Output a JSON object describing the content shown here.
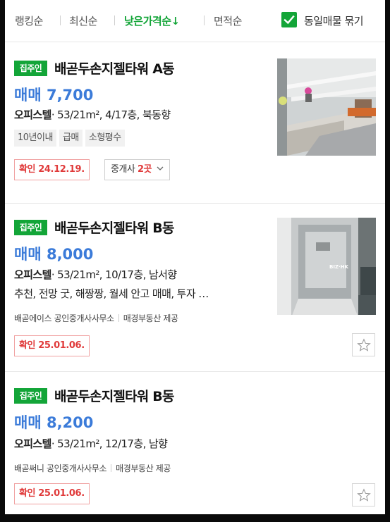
{
  "sort_bar": {
    "options": [
      {
        "label": "랭킹순"
      },
      {
        "label": "최신순"
      },
      {
        "label": "낮은가격순↓",
        "active": true
      },
      {
        "label": "면적순"
      }
    ],
    "same_listing_checkbox": {
      "label": "동일매물 묶기",
      "checked": true
    }
  },
  "listings": [
    {
      "badge": "집주인",
      "title": "배곧두손지젤타워 A동",
      "price": "매매 7,700",
      "type": "오피스텔",
      "spec": "· 53/21m², 4/17층, 북동향",
      "tags": [
        "10년이내",
        "급매",
        "소형평수"
      ],
      "confirm": "확인 24.12.19.",
      "agency_label": "중개사 ",
      "agency_count": "2곳",
      "thumbnail_icon": "room-interior-photo"
    },
    {
      "badge": "집주인",
      "title": "배곧두손지젤타워 B동",
      "price": "매매 8,000",
      "type": "오피스텔",
      "spec": "· 53/21m², 10/17층, 남서향",
      "description": "추천, 전망 굿, 해짱짱, 월세 안고 매매, 투자 …",
      "agent": "배곧에이스 공인중개사사무소",
      "provider": "매경부동산 제공",
      "confirm": "확인 25.01.06.",
      "thumbnail_icon": "hallway-photo"
    },
    {
      "badge": "집주인",
      "title": "배곧두손지젤타워 B동",
      "price": "매매 8,200",
      "type": "오피스텔",
      "spec": "· 53/21m², 12/17층, 남향",
      "agent": "배곧써니 공인중개사사무소",
      "provider": "매경부동산 제공",
      "confirm": "확인 25.01.06."
    }
  ],
  "colors": {
    "brand_green": "#13a538",
    "price_blue": "#3b7bd9",
    "confirm_red": "#e03a3a"
  }
}
